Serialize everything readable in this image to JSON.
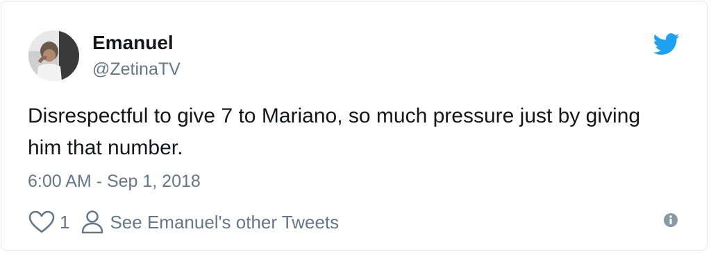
{
  "author": {
    "name": "Emanuel",
    "handle": "@ZetinaTV"
  },
  "tweet": {
    "text": "Disrespectful to give 7 to Mariano, so much pressure just by giving him that number.",
    "timestamp": "6:00 AM - Sep 1, 2018"
  },
  "actions": {
    "like_count": "1",
    "other_tweets_label": "See Emanuel's other Tweets"
  },
  "icons": {
    "brand": "twitter-bird-icon",
    "like": "heart-icon",
    "profile": "person-icon",
    "info": "info-icon"
  },
  "colors": {
    "brand": "#1da1f2",
    "text": "#14171a",
    "secondary": "#657786",
    "border": "#e1e8ed"
  }
}
